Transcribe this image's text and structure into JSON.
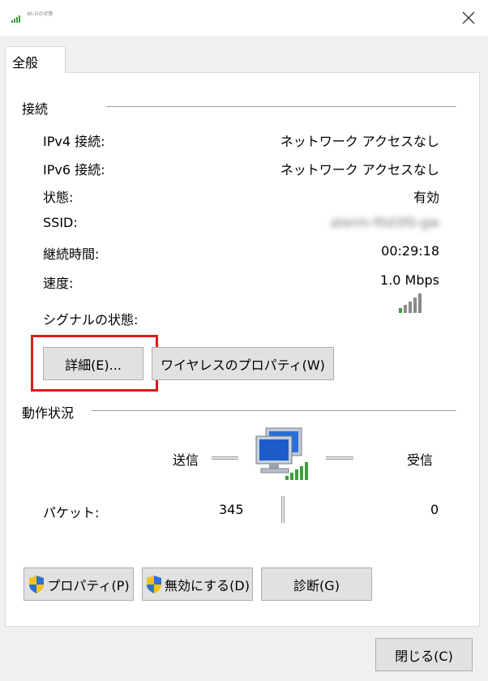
{
  "window": {
    "title": "Wi-Fiの状態",
    "close_icon": "close-icon"
  },
  "tab": {
    "label": "全般"
  },
  "connection": {
    "title": "接続",
    "rows": [
      {
        "label": "IPv4 接続:",
        "value": "ネットワーク アクセスなし"
      },
      {
        "label": "IPv6 接続:",
        "value": "ネットワーク アクセスなし"
      },
      {
        "label": "状態:",
        "value": "有効"
      },
      {
        "label": "SSID:",
        "value": "aterm-f0d3f0-gw"
      },
      {
        "label": "継続時間:",
        "value": "00:29:18"
      },
      {
        "label": "速度:",
        "value": "1.0 Mbps"
      }
    ],
    "signal_label": "シグナルの状態:",
    "signal_level": 1,
    "signal_max": 5,
    "details_button": "詳細(E)...",
    "wireless_props_button": "ワイヤレスのプロパティ(W)"
  },
  "activity": {
    "title": "動作状況",
    "sent_label": "送信",
    "received_label": "受信",
    "packets_label": "パケット:",
    "packets_sent": "345",
    "packets_received": "0"
  },
  "buttons": {
    "properties": "プロパティ(P)",
    "disable": "無効にする(D)",
    "diagnose": "診断(G)",
    "close": "閉じる(C)"
  },
  "colors": {
    "signal_active": "#3aa03a",
    "signal_inactive": "#8a8a8a",
    "highlight": "#e01818"
  }
}
